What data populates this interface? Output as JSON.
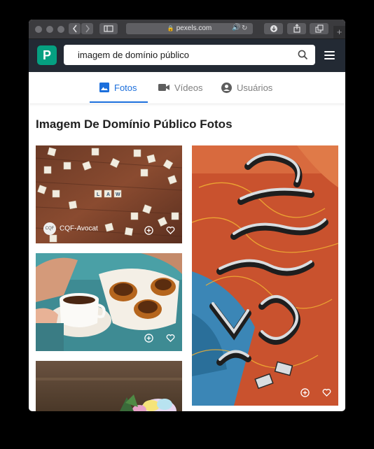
{
  "browser": {
    "url": "pexels.com"
  },
  "header": {
    "logo_letter": "P",
    "search_value": "imagem de domínio público"
  },
  "tabs": [
    {
      "label": "Fotos",
      "active": true
    },
    {
      "label": "Vídeos",
      "active": false
    },
    {
      "label": "Usuários",
      "active": false
    }
  ],
  "page": {
    "title": "Imagem De Domínio Público Fotos"
  },
  "photos": [
    {
      "description": "scrabble-letters-law",
      "author": "CQF-Avocat"
    },
    {
      "description": "coffee-and-pastries"
    },
    {
      "description": "metal-letter-signs"
    },
    {
      "description": "cupcake-on-wood"
    }
  ],
  "colors": {
    "accent": "#1c6fdc",
    "brand": "#05a081",
    "header_bg": "#232a34"
  }
}
